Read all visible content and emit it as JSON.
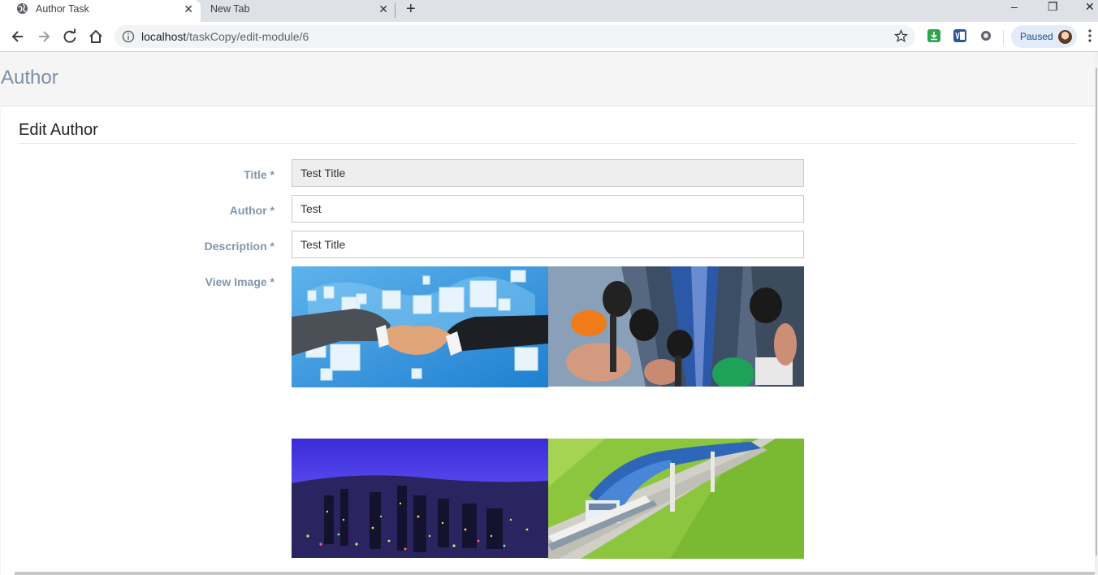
{
  "browser": {
    "tabs": [
      {
        "title": "Author Task"
      },
      {
        "title": "New Tab"
      }
    ],
    "new_tab_symbol": "+",
    "address": {
      "host": "localhost",
      "path": "/taskCopy/edit-module/6"
    },
    "profile_status": "Paused",
    "window_controls": {
      "minimize": "–",
      "restore": "❐",
      "close": "✕"
    },
    "icons": [
      "back-icon",
      "forward-icon",
      "reload-icon",
      "home-icon",
      "info-icon",
      "star-icon",
      "download-extension-icon",
      "translate-extension-icon",
      "circle-extension-icon",
      "avatar-icon",
      "menu-icon"
    ]
  },
  "page": {
    "title": "Author",
    "panel_heading": "Edit Author",
    "form": {
      "title": {
        "label": "Title *",
        "value": "Test Title",
        "readonly": true
      },
      "author": {
        "label": "Author *",
        "value": "Test"
      },
      "description": {
        "label": "Description *",
        "value": "Test Title"
      },
      "images": {
        "label": "View Image *",
        "items": [
          "handshake-network-image",
          "press-microphones-image",
          "city-night-image",
          "metro-station-image"
        ]
      }
    }
  }
}
